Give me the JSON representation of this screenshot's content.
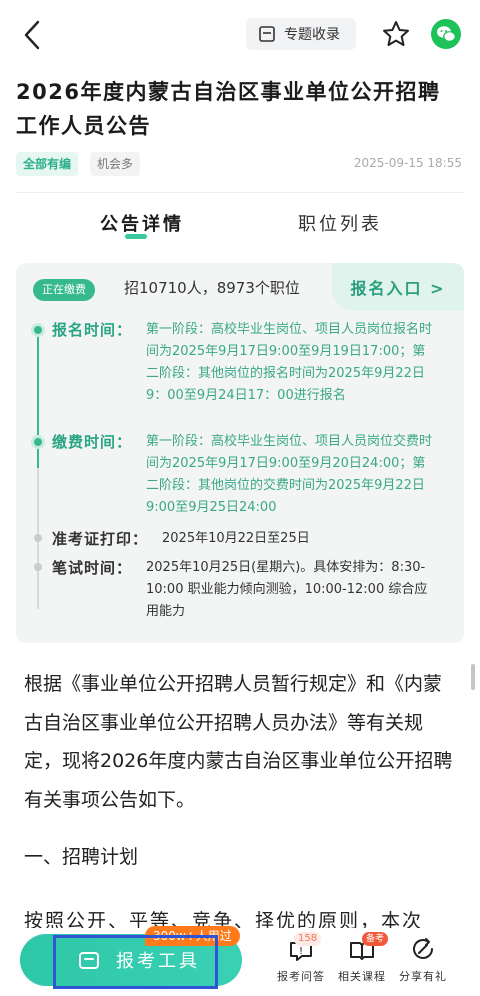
{
  "header": {
    "collect_label": "专题收录",
    "icons": [
      "back-icon",
      "folder-icon",
      "star-icon",
      "wechat-icon"
    ]
  },
  "article": {
    "title": "2026年度内蒙古自治区事业单位公开招聘工作人员公告",
    "tags": [
      "全部有编",
      "机会多"
    ],
    "date": "2025-09-15  18:55"
  },
  "tabs": [
    "公告详情",
    "职位列表"
  ],
  "card": {
    "status": "正在缴费",
    "summary": "招10710人，8973个职位",
    "entry": "报名入口 >",
    "rows": [
      {
        "label": "报名时间：",
        "text": "第一阶段：高校毕业生岗位、项目人员岗位报名时间为2025年9月17日9:00至9月19日17:00；第二阶段：其他岗位的报名时间为2025年9月22日9：00至9月24日17：00进行报名"
      },
      {
        "label": "缴费时间：",
        "text": "第一阶段：高校毕业生岗位、项目人员岗位交费时间为2025年9月17日9:00至9月20日24:00；第二阶段：其他岗位的交费时间为2025年9月22日9:00至9月25日24:00"
      },
      {
        "label": "准考证打印：",
        "text": "2025年10月22日至25日"
      },
      {
        "label": "笔试时间：",
        "text": "2025年10月25日(星期六)。具体安排为：8:30-10:00 职业能力倾向测验，10:00-12:00 综合应用能力"
      }
    ]
  },
  "content": {
    "paragraph": "根据《事业单位公开招聘人员暂行规定》和《内蒙古自治区事业单位公开招聘人员办法》等有关规定，现将2026年度内蒙古自治区事业单位公开招聘有关事项公告如下。",
    "section": "一、招聘计划",
    "cut_line": "按照公开、平等、竞争、择优的原则，本次"
  },
  "bottom": {
    "tools_label": "报考工具",
    "hot_badge": "300w+人用过",
    "nav": [
      {
        "label": "报考问答",
        "badge": "158"
      },
      {
        "label": "相关课程",
        "badge": "备考"
      },
      {
        "label": "分享有礼",
        "badge": ""
      }
    ]
  },
  "colors": {
    "accent": "#37b98f",
    "accent_light": "#e0f3ec",
    "wechat": "#1dc259",
    "highlight": "#2f55d4",
    "hot": "#ff7a1a"
  }
}
